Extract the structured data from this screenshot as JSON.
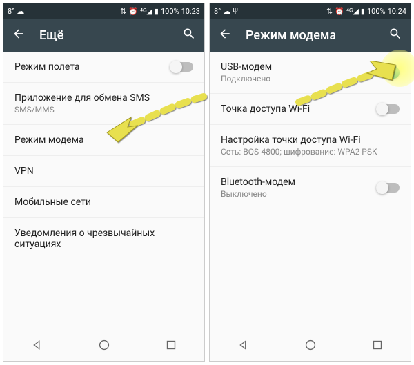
{
  "left": {
    "status": {
      "temp": "8°",
      "signal": "⁴ᴳ◢",
      "battery": "100%",
      "time": "10:23"
    },
    "appbar": {
      "title": "Ещё"
    },
    "items": [
      {
        "title": "Режим полета",
        "sub": "",
        "toggle": "off"
      },
      {
        "title": "Приложение для обмена SMS",
        "sub": "SMS/MMS"
      },
      {
        "title": "Режим модема",
        "sub": ""
      },
      {
        "title": "VPN",
        "sub": ""
      },
      {
        "title": "Мобильные сети",
        "sub": ""
      },
      {
        "title": "Уведомления о чрезвычайных ситуациях",
        "sub": ""
      }
    ]
  },
  "right": {
    "status": {
      "temp": "8°",
      "signal": "⁴ᴳ◢",
      "battery": "100%",
      "time": "10:24"
    },
    "appbar": {
      "title": "Режим модема"
    },
    "items": [
      {
        "title": "USB-модем",
        "sub": "Подключено",
        "toggle": "on"
      },
      {
        "title": "Точка доступа Wi-Fi",
        "sub": "",
        "toggle": "off"
      },
      {
        "title": "Настройка точки доступа Wi-Fi",
        "sub": "Сеть: BQS-4800; шифрование: WPA2 PSK"
      },
      {
        "title": "Bluetooth-модем",
        "sub": "Выключено",
        "toggle": "off"
      }
    ]
  }
}
